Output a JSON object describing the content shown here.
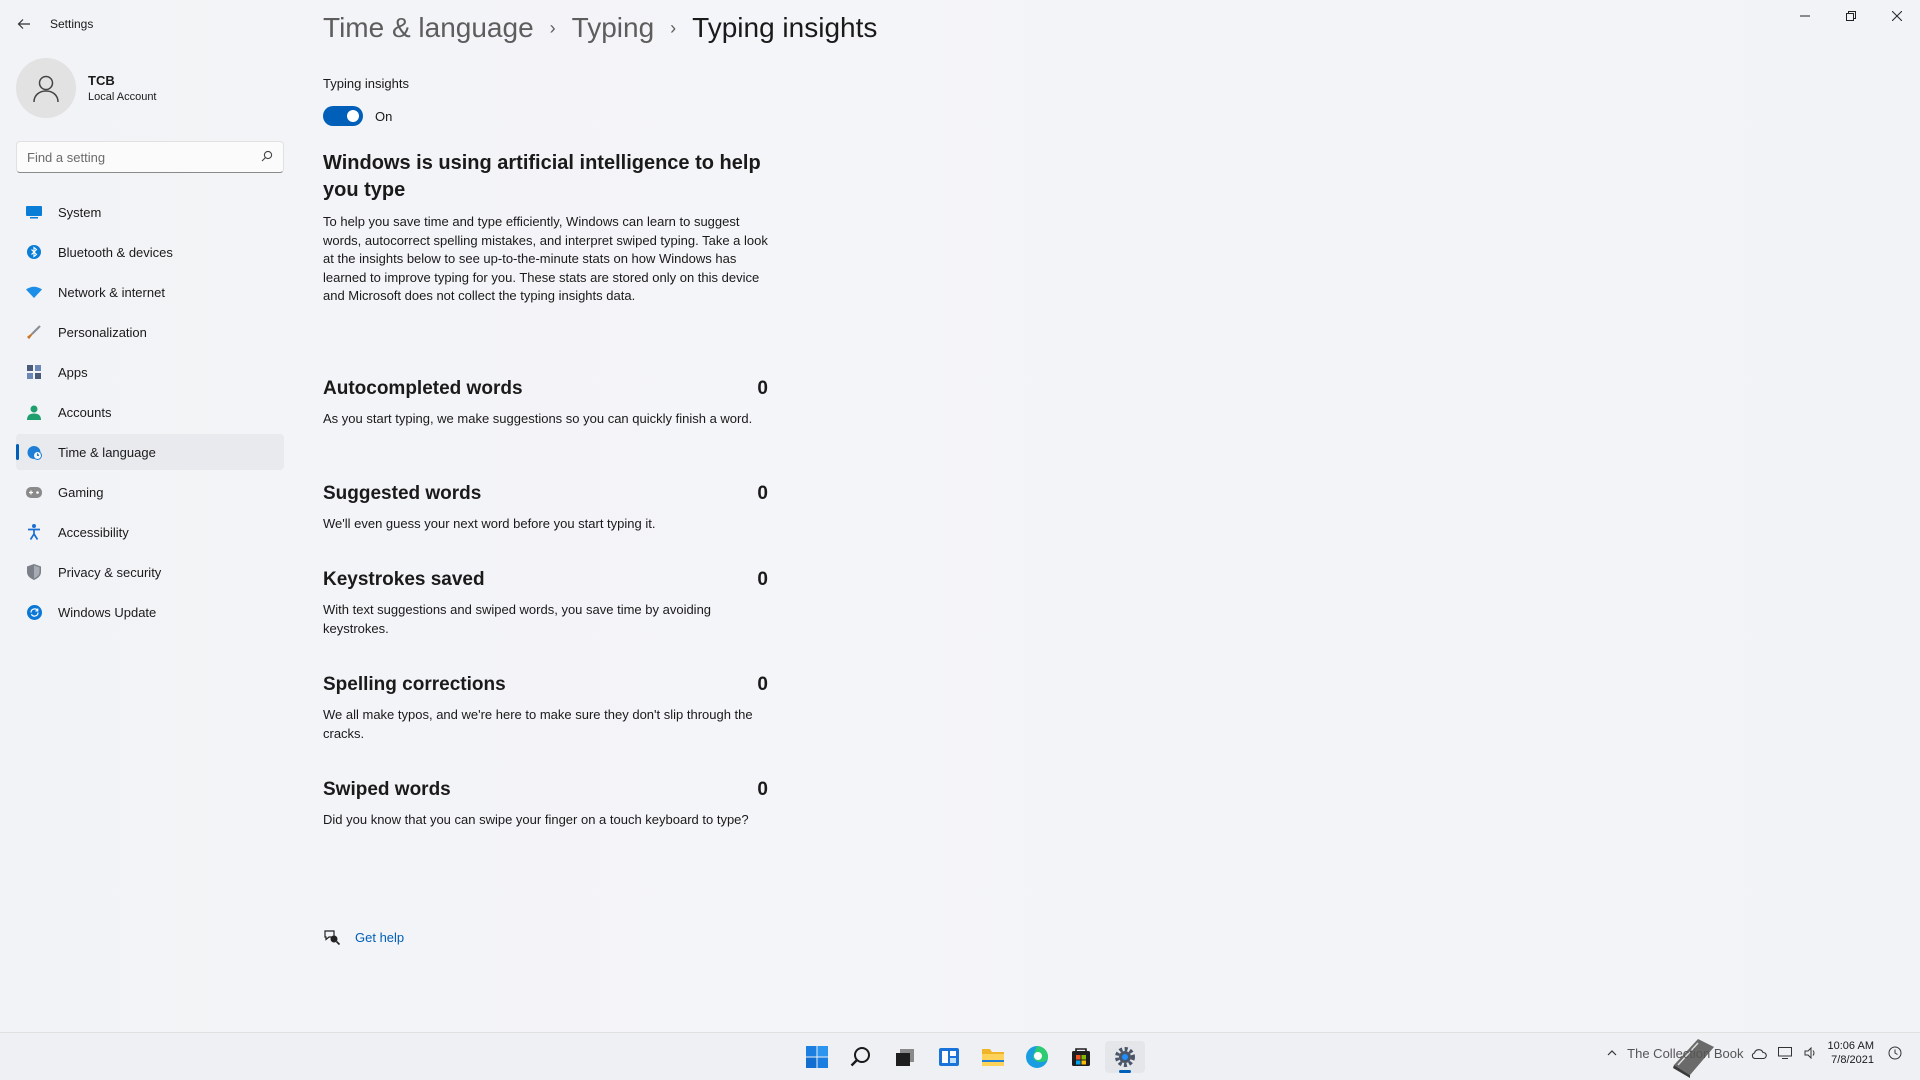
{
  "window": {
    "app_title": "Settings",
    "controls": {
      "minimize": "—",
      "maximize": "□",
      "close": "✕"
    }
  },
  "sidebar": {
    "profile": {
      "name": "TCB",
      "account_type": "Local Account"
    },
    "search": {
      "placeholder": "Find a setting"
    },
    "items": [
      {
        "label": "System",
        "icon": "system-icon",
        "color": "#0067c0"
      },
      {
        "label": "Bluetooth & devices",
        "icon": "bluetooth-icon",
        "color": "#0a7dd6"
      },
      {
        "label": "Network & internet",
        "icon": "wifi-icon",
        "color": "#1b8ee8"
      },
      {
        "label": "Personalization",
        "icon": "brush-icon",
        "color": "#b56a28"
      },
      {
        "label": "Apps",
        "icon": "apps-icon",
        "color": "#4a5b7a"
      },
      {
        "label": "Accounts",
        "icon": "person-icon",
        "color": "#1f9e6e"
      },
      {
        "label": "Time & language",
        "icon": "globe-clock-icon",
        "color": "#1f7fd6",
        "active": true
      },
      {
        "label": "Gaming",
        "icon": "gamepad-icon",
        "color": "#7a7a7a"
      },
      {
        "label": "Accessibility",
        "icon": "accessibility-icon",
        "color": "#1b6fd0"
      },
      {
        "label": "Privacy & security",
        "icon": "shield-icon",
        "color": "#6b6f78"
      },
      {
        "label": "Windows Update",
        "icon": "update-icon",
        "color": "#0a78d4"
      }
    ]
  },
  "breadcrumb": {
    "items": [
      "Time & language",
      "Typing",
      "Typing insights"
    ],
    "separator": "›"
  },
  "typing_insights": {
    "toggle_label": "Typing insights",
    "toggle_state": "On",
    "toggle_on": true
  },
  "heading": "Windows is using artificial intelligence to help you type",
  "intro": "To help you save time and type efficiently, Windows can learn to suggest words, autocorrect spelling mistakes, and interpret swiped typing. Take a look at the insights below to see up-to-the-minute stats on how Windows has learned to improve typing for you. These stats are stored only on this device and Microsoft does not collect the typing insights data.",
  "stats": [
    {
      "title": "Autocompleted words",
      "value": "0",
      "desc": "As you start typing, we make suggestions so you can quickly finish a word."
    },
    {
      "title": "Suggested words",
      "value": "0",
      "desc": "We'll even guess your next word before you start typing it."
    },
    {
      "title": "Keystrokes saved",
      "value": "0",
      "desc": "With text suggestions and swiped words, you save time by avoiding keystrokes."
    },
    {
      "title": "Spelling corrections",
      "value": "0",
      "desc": "We all make typos, and we're here to make sure they don't slip through the cracks."
    },
    {
      "title": "Swiped words",
      "value": "0",
      "desc": "Did you know that you can swipe your finger on a touch keyboard to type?"
    }
  ],
  "help": {
    "label": "Get help"
  },
  "taskbar": {
    "apps": [
      {
        "icon": "start-icon"
      },
      {
        "icon": "search-icon"
      },
      {
        "icon": "task-view-icon"
      },
      {
        "icon": "widgets-icon"
      },
      {
        "icon": "file-explorer-icon"
      },
      {
        "icon": "edge-icon"
      },
      {
        "icon": "store-icon"
      },
      {
        "icon": "settings-gear-icon",
        "active": true
      }
    ],
    "tray": {
      "overlay_text": "The Collection Book",
      "time": "10:06 AM",
      "date": "7/8/2021"
    }
  },
  "colors": {
    "accent": "#005fb8",
    "link": "#005fb8"
  }
}
